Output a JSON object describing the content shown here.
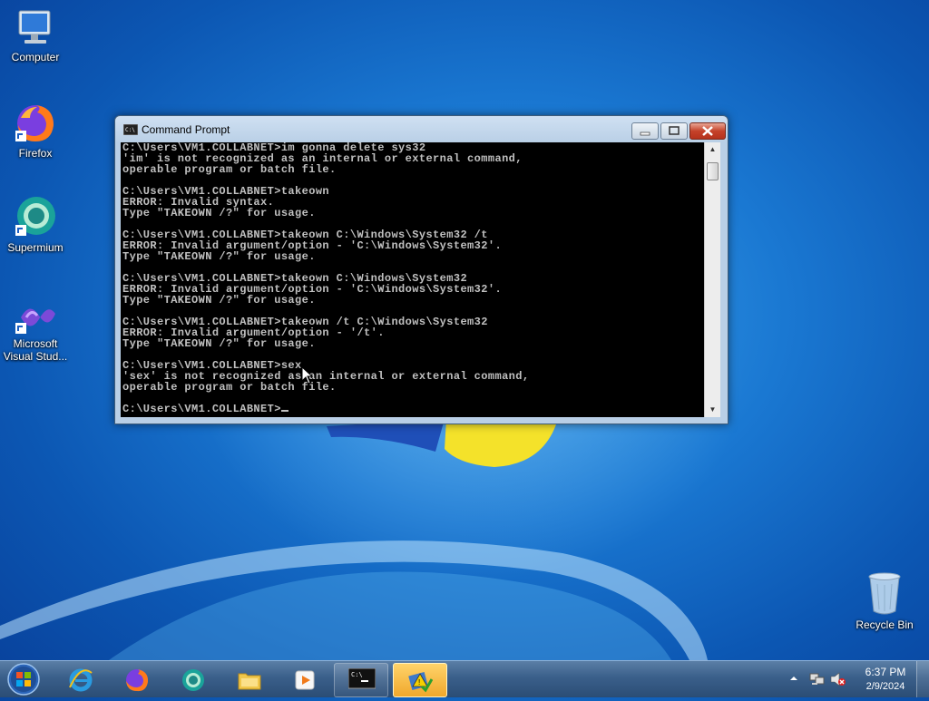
{
  "desktop": {
    "icons": [
      {
        "label": "Computer",
        "icon": "computer-icon"
      },
      {
        "label": "Firefox",
        "icon": "firefox-icon"
      },
      {
        "label": "Supermium",
        "icon": "supermium-icon"
      },
      {
        "label": "Microsoft Visual Stud...",
        "label_line1": "Microsoft",
        "label_line2": "Visual Stud...",
        "icon": "visual-studio-icon"
      },
      {
        "label": "Recycle Bin",
        "icon": "recycle-bin-icon"
      }
    ]
  },
  "window": {
    "title": "Command Prompt",
    "console_lines": [
      "C:\\Users\\VM1.COLLABNET>im gonna delete sys32",
      "'im' is not recognized as an internal or external command,",
      "operable program or batch file.",
      "",
      "C:\\Users\\VM1.COLLABNET>takeown",
      "ERROR: Invalid syntax.",
      "Type \"TAKEOWN /?\" for usage.",
      "",
      "C:\\Users\\VM1.COLLABNET>takeown C:\\Windows\\System32 /t",
      "ERROR: Invalid argument/option - 'C:\\Windows\\System32'.",
      "Type \"TAKEOWN /?\" for usage.",
      "",
      "C:\\Users\\VM1.COLLABNET>takeown C:\\Windows\\System32",
      "ERROR: Invalid argument/option - 'C:\\Windows\\System32'.",
      "Type \"TAKEOWN /?\" for usage.",
      "",
      "C:\\Users\\VM1.COLLABNET>takeown /t C:\\Windows\\System32",
      "ERROR: Invalid argument/option - '/t'.",
      "Type \"TAKEOWN /?\" for usage.",
      "",
      "C:\\Users\\VM1.COLLABNET>sex",
      "'sex' is not recognized as an internal or external command,",
      "operable program or batch file.",
      ""
    ],
    "prompt": "C:\\Users\\VM1.COLLABNET>",
    "colors": {
      "console_bg": "#000000",
      "console_fg": "#c0c0c0"
    }
  },
  "taskbar": {
    "pinned": [
      "internet-explorer-icon",
      "firefox-icon",
      "supermium-icon",
      "file-explorer-icon",
      "media-player-icon",
      "command-prompt-icon",
      "active-app-icon"
    ],
    "clock": {
      "time": "6:37 PM",
      "date": "2/9/2024"
    },
    "tray_icons": [
      "show-hidden-icons-chevron",
      "network-icon",
      "volume-muted-icon"
    ]
  }
}
